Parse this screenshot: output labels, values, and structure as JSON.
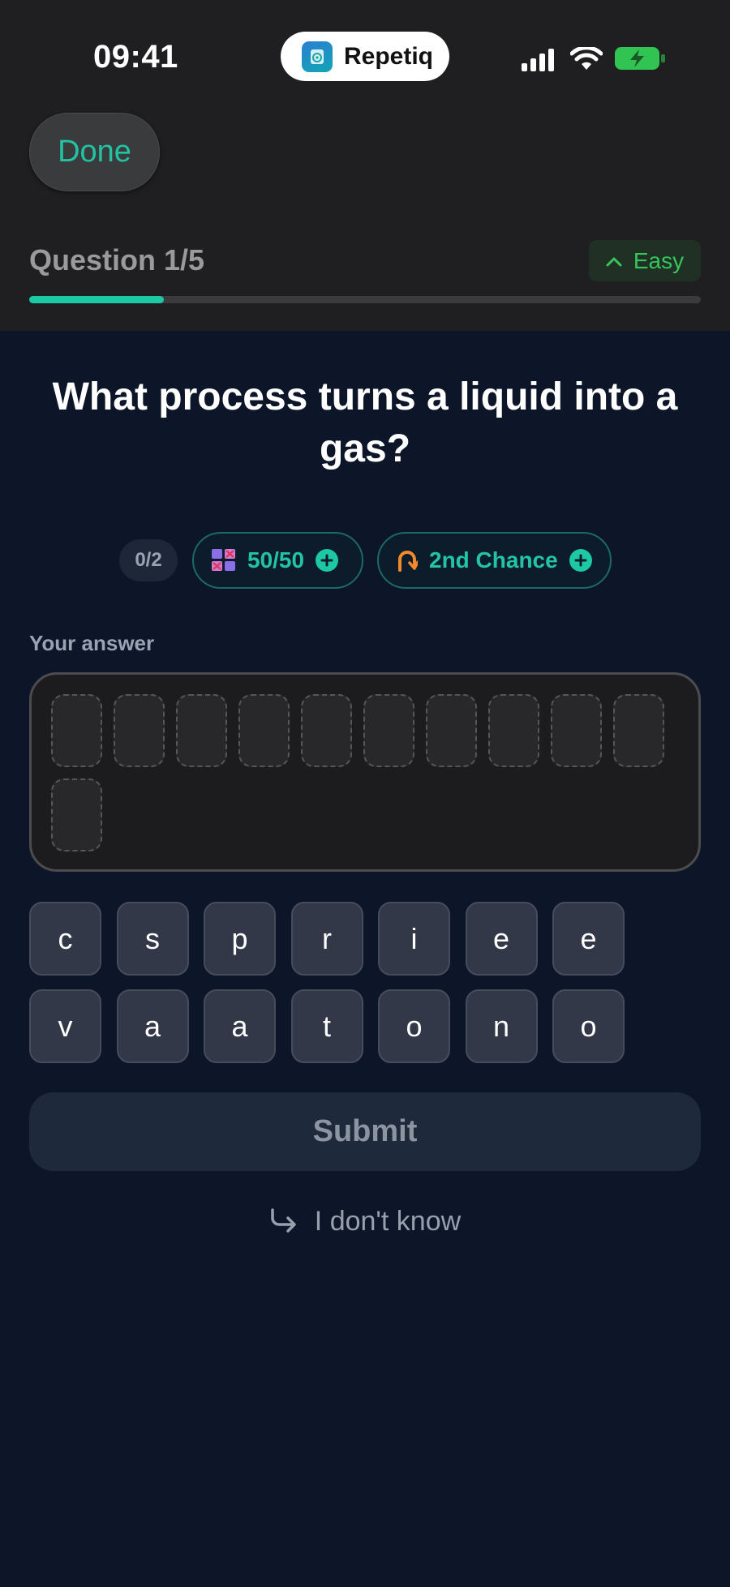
{
  "status_bar": {
    "time": "09:41",
    "app_name": "Repetiq",
    "battery_color": "#32c453"
  },
  "header": {
    "done_label": "Done",
    "question_counter": "Question 1/5",
    "difficulty": "Easy",
    "progress_fraction": 0.2,
    "accent_color": "#1cc9a4"
  },
  "question": {
    "text": "What process turns a liquid into a gas?"
  },
  "lifelines": {
    "uses": "0/2",
    "items": [
      {
        "label": "50/50",
        "icon": "fifty-fifty-icon"
      },
      {
        "label": "2nd Chance",
        "icon": "second-chance-icon"
      }
    ]
  },
  "answer": {
    "label": "Your answer",
    "slot_count": 11
  },
  "letters": {
    "row1": [
      "c",
      "s",
      "p",
      "r",
      "i",
      "e",
      "e"
    ],
    "row2": [
      "v",
      "a",
      "a",
      "t",
      "o",
      "n",
      "o"
    ]
  },
  "actions": {
    "submit_label": "Submit",
    "dont_know_label": "I don't know"
  }
}
